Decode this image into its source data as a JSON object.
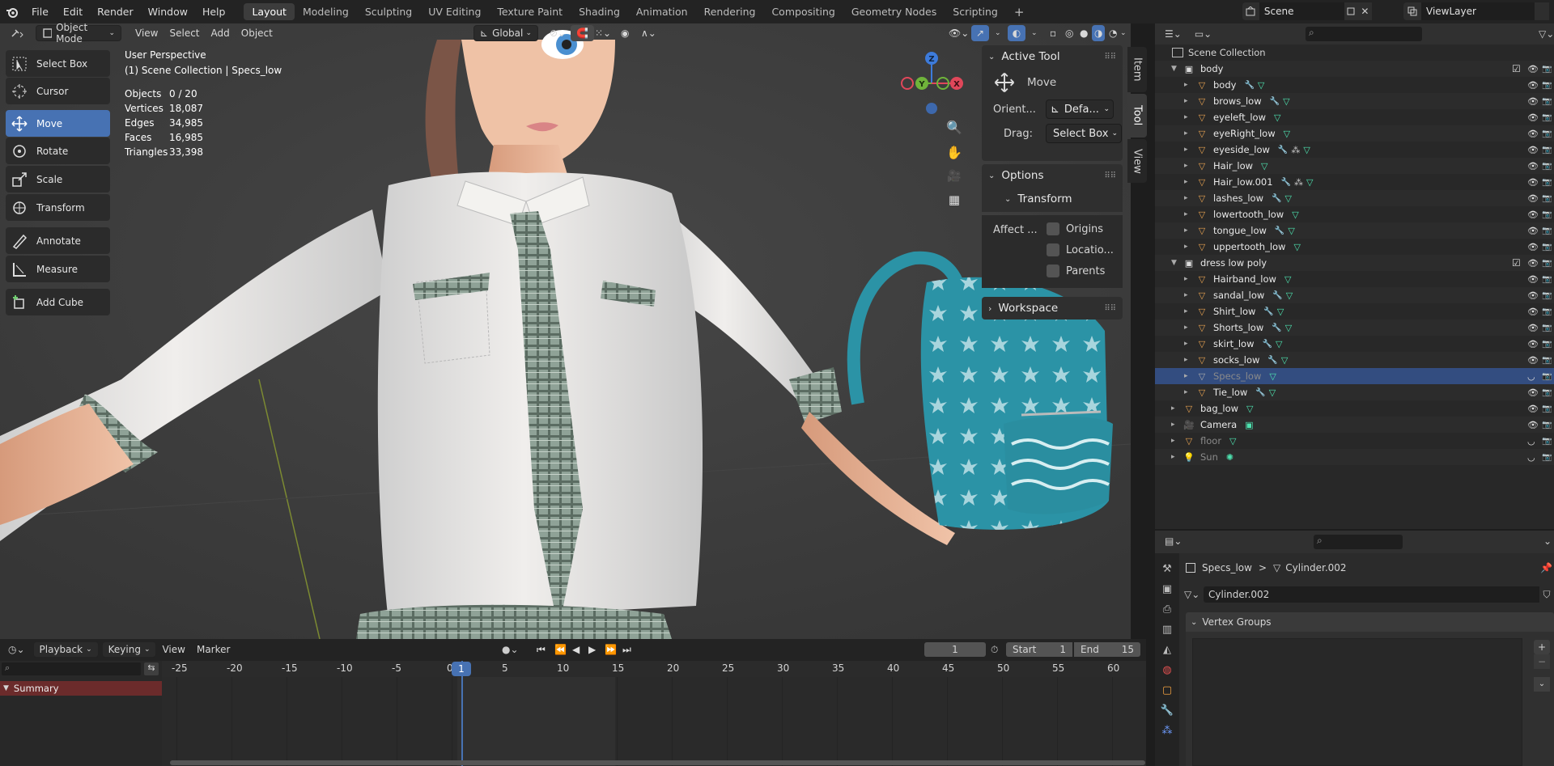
{
  "topbar": {
    "menus": [
      "File",
      "Edit",
      "Render",
      "Window",
      "Help"
    ],
    "workspaces": [
      "Layout",
      "Modeling",
      "Sculpting",
      "UV Editing",
      "Texture Paint",
      "Shading",
      "Animation",
      "Rendering",
      "Compositing",
      "Geometry Nodes",
      "Scripting"
    ],
    "active_workspace": "Layout",
    "add_tab": "+",
    "scene_label": "Scene",
    "viewlayer_label": "ViewLayer"
  },
  "viewport_header": {
    "mode": "Object Mode",
    "menus": [
      "View",
      "Select",
      "Add",
      "Object"
    ],
    "orientation": "Global"
  },
  "toolbar": [
    {
      "label": "Select Box",
      "icon": "select-box-icon"
    },
    {
      "label": "Cursor",
      "icon": "cursor-icon"
    },
    {
      "label": "Move",
      "icon": "move-icon",
      "active": true
    },
    {
      "label": "Rotate",
      "icon": "rotate-icon"
    },
    {
      "label": "Scale",
      "icon": "scale-icon"
    },
    {
      "label": "Transform",
      "icon": "transform-icon"
    },
    {
      "label": "Annotate",
      "icon": "annotate-icon"
    },
    {
      "label": "Measure",
      "icon": "measure-icon"
    },
    {
      "label": "Add Cube",
      "icon": "add-cube-icon"
    }
  ],
  "overlay": {
    "perspective": "User Perspective",
    "collection": "(1) Scene Collection | Specs_low",
    "stats": [
      {
        "label": "Objects",
        "value": "0 / 20"
      },
      {
        "label": "Vertices",
        "value": "18,087"
      },
      {
        "label": "Edges",
        "value": "34,985"
      },
      {
        "label": "Faces",
        "value": "16,985"
      },
      {
        "label": "Triangles",
        "value": "33,398"
      }
    ]
  },
  "gizmo": {
    "z": "Z",
    "y": "Y",
    "x": "X"
  },
  "tool_panel": {
    "active_tool_title": "Active Tool",
    "tool_name": "Move",
    "orient_label": "Orient...",
    "orient_value": "Defa...",
    "drag_label": "Drag:",
    "drag_value": "Select Box",
    "options_title": "Options",
    "transform_title": "Transform",
    "affect_label": "Affect ...",
    "affect_options": [
      "Origins",
      "Locatio...",
      "Parents"
    ],
    "workspace_title": "Workspace"
  },
  "side_tabs": [
    "Item",
    "Tool",
    "View"
  ],
  "outliner": {
    "root": "Scene Collection",
    "rows": [
      {
        "name": "body",
        "kind": "collection",
        "depth": 1,
        "checked": true
      },
      {
        "name": "body",
        "kind": "mesh",
        "depth": 2,
        "mod": true
      },
      {
        "name": "brows_low",
        "kind": "mesh",
        "depth": 2,
        "mod": true
      },
      {
        "name": "eyeleft_low",
        "kind": "mesh",
        "depth": 2,
        "mod": false
      },
      {
        "name": "eyeRight_low",
        "kind": "mesh",
        "depth": 2,
        "mod": false
      },
      {
        "name": "eyeside_low",
        "kind": "mesh",
        "depth": 2,
        "mod": true,
        "extra": true
      },
      {
        "name": "Hair_low",
        "kind": "mesh",
        "depth": 2,
        "mod": false
      },
      {
        "name": "Hair_low.001",
        "kind": "mesh",
        "depth": 2,
        "mod": true,
        "extra": true
      },
      {
        "name": "lashes_low",
        "kind": "mesh",
        "depth": 2,
        "mod": true
      },
      {
        "name": "lowertooth_low",
        "kind": "mesh",
        "depth": 2,
        "mod": false
      },
      {
        "name": "tongue_low",
        "kind": "mesh",
        "depth": 2,
        "mod": true
      },
      {
        "name": "uppertooth_low",
        "kind": "mesh",
        "depth": 2,
        "mod": false
      },
      {
        "name": "dress low poly",
        "kind": "collection",
        "depth": 1,
        "checked": true
      },
      {
        "name": "Hairband_low",
        "kind": "mesh",
        "depth": 2,
        "mod": false
      },
      {
        "name": "sandal_low",
        "kind": "mesh",
        "depth": 2,
        "mod": true
      },
      {
        "name": "Shirt_low",
        "kind": "mesh",
        "depth": 2,
        "mod": true
      },
      {
        "name": "Shorts_low",
        "kind": "mesh",
        "depth": 2,
        "mod": true
      },
      {
        "name": "skirt_low",
        "kind": "mesh",
        "depth": 2,
        "mod": true
      },
      {
        "name": "socks_low",
        "kind": "mesh",
        "depth": 2,
        "mod": true
      },
      {
        "name": "Specs_low",
        "kind": "mesh",
        "depth": 2,
        "mod": false,
        "selected": true,
        "hidden": true
      },
      {
        "name": "Tie_low",
        "kind": "mesh",
        "depth": 2,
        "mod": true
      },
      {
        "name": "bag_low",
        "kind": "mesh",
        "depth": 1,
        "mod": false
      },
      {
        "name": "Camera",
        "kind": "camera",
        "depth": 1
      },
      {
        "name": "floor",
        "kind": "mesh",
        "depth": 1,
        "hidden": true
      },
      {
        "name": "Sun",
        "kind": "light",
        "depth": 1,
        "hidden": true
      }
    ]
  },
  "properties": {
    "breadcrumb_object": "Specs_low",
    "breadcrumb_sep": ">",
    "breadcrumb_data": "Cylinder.002",
    "data_name": "Cylinder.002",
    "vertex_groups_title": "Vertex Groups",
    "add_btn": "+",
    "remove_btn": "−"
  },
  "timeline": {
    "menus": [
      "Playback",
      "Keying",
      "View",
      "Marker"
    ],
    "current_frame": "1",
    "start_label": "Start",
    "start_value": "1",
    "end_label": "End",
    "end_value": "15",
    "ruler": [
      "-25",
      "-20",
      "-15",
      "-10",
      "-5",
      "0",
      "5",
      "10",
      "15",
      "20",
      "25",
      "30",
      "35",
      "40",
      "45",
      "50",
      "55",
      "60"
    ],
    "playhead": "1",
    "summary": "Summary"
  },
  "colors": {
    "accent": "#4772b3",
    "selected_row": "#334d80",
    "mesh_icon": "#e5a050",
    "data_icon": "#4ee3b0",
    "modifier_icon": "#7ea6ff",
    "summary_bg": "#6b2b2b"
  }
}
